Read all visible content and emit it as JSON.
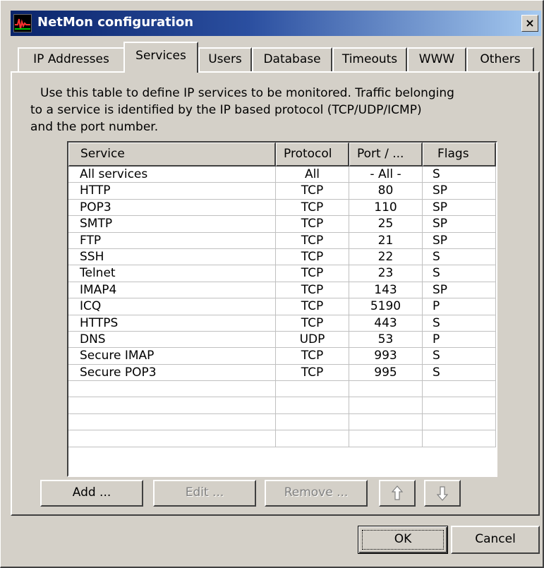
{
  "window": {
    "title": "NetMon configuration",
    "close_label": "×"
  },
  "tabs": [
    {
      "label": "IP Addresses"
    },
    {
      "label": "Services"
    },
    {
      "label": "Users"
    },
    {
      "label": "Database"
    },
    {
      "label": "Timeouts"
    },
    {
      "label": "WWW"
    },
    {
      "label": "Others"
    }
  ],
  "active_tab": "Services",
  "description": {
    "line1": "Use this table to define IP services to be monitored.  Traffic belonging",
    "line2": "to a service is identified by the IP based protocol (TCP/UDP/ICMP)",
    "line3": "and the port number."
  },
  "table": {
    "columns": [
      "Service",
      "Protocol",
      "Port / ...",
      "Flags"
    ],
    "rows": [
      [
        "All services",
        "All",
        "- All -",
        "S"
      ],
      [
        "HTTP",
        "TCP",
        "80",
        "SP"
      ],
      [
        "POP3",
        "TCP",
        "110",
        "SP"
      ],
      [
        "SMTP",
        "TCP",
        "25",
        "SP"
      ],
      [
        "FTP",
        "TCP",
        "21",
        "SP"
      ],
      [
        "SSH",
        "TCP",
        "22",
        "S"
      ],
      [
        "Telnet",
        "TCP",
        "23",
        "S"
      ],
      [
        "IMAP4",
        "TCP",
        "143",
        "SP"
      ],
      [
        "ICQ",
        "TCP",
        "5190",
        " P"
      ],
      [
        "HTTPS",
        "TCP",
        "443",
        "S"
      ],
      [
        "DNS",
        "UDP",
        "53",
        " P"
      ],
      [
        "Secure IMAP",
        "TCP",
        "993",
        "S"
      ],
      [
        "Secure POP3",
        "TCP",
        "995",
        "S"
      ],
      [
        "",
        "",
        "",
        ""
      ],
      [
        "",
        "",
        "",
        ""
      ],
      [
        "",
        "",
        "",
        ""
      ],
      [
        "",
        "",
        "",
        ""
      ]
    ]
  },
  "buttons": {
    "add": "Add ...",
    "edit": "Edit ...",
    "remove": "Remove ...",
    "up_icon": "arrow-up-icon",
    "down_icon": "arrow-down-icon",
    "ok": "OK",
    "cancel": "Cancel"
  },
  "colors": {
    "title_start": "#0a246a",
    "title_end": "#a6caf0",
    "face": "#d4d0c8"
  }
}
